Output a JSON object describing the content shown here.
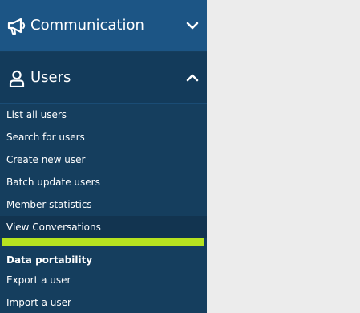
{
  "colors": {
    "sidebar_bg": "#153e5e",
    "communication_header_bg": "#1c5585",
    "users_header_bg": "#133b5b",
    "selected_item_bg": "#123450",
    "active_indicator": "#b6e320",
    "content_bg": "#ececec",
    "text": "#ffffff"
  },
  "sidebar": {
    "sections": [
      {
        "label": "Communication",
        "icon": "megaphone-icon",
        "chevron": "chevron-down-icon",
        "expanded": false
      },
      {
        "label": "Users",
        "icon": "user-icon",
        "chevron": "chevron-up-icon",
        "expanded": true,
        "items": [
          {
            "label": "List all users"
          },
          {
            "label": "Search for users"
          },
          {
            "label": "Create new user"
          },
          {
            "label": "Batch update users"
          },
          {
            "label": "Member statistics"
          },
          {
            "label": "View Conversations",
            "selected": true
          }
        ],
        "subsection": {
          "title": "Data portability",
          "items": [
            {
              "label": "Export a user"
            },
            {
              "label": "Import a user"
            }
          ]
        }
      }
    ]
  }
}
